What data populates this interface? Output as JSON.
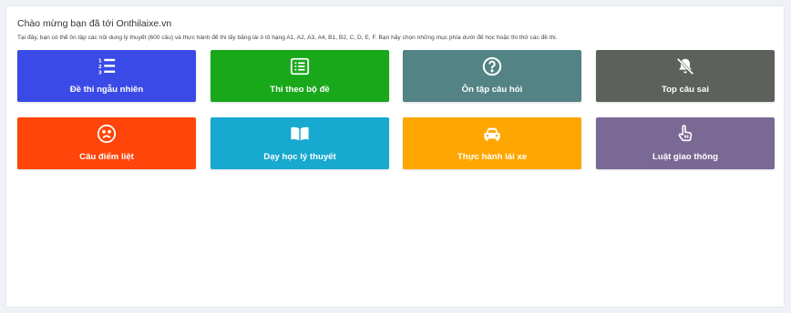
{
  "header": {
    "welcome": "Chào mừng bạn đã tới Onthilaixe.vn",
    "intro": "Tại đây, bạn có thể ôn tập các nội dung lý thuyết (600 câu) và thực hành để thi lấy bằng lái ô tô hạng A1, A2, A3, A4, B1, B2, C, D, E, F. Bạn hãy chọn những mục phía dưới để học hoặc thi thử các đề thi."
  },
  "tiles": [
    {
      "label": "Đề thi ngẫu nhiên",
      "icon": "numbered-list-icon",
      "color": "#3a4ae6"
    },
    {
      "label": "Thi theo bộ đề",
      "icon": "list-alt-icon",
      "color": "#18a81a"
    },
    {
      "label": "Ôn tập câu hỏi",
      "icon": "question-circle-icon",
      "color": "#538384"
    },
    {
      "label": "Top câu sai",
      "icon": "bell-slash-icon",
      "color": "#5c615c"
    },
    {
      "label": "Câu điểm liệt",
      "icon": "frown-icon",
      "color": "#ff4509"
    },
    {
      "label": "Dạy học lý thuyết",
      "icon": "open-book-icon",
      "color": "#17a9cf"
    },
    {
      "label": "Thực hành lái xe",
      "icon": "car-icon",
      "color": "#ffa600"
    },
    {
      "label": "Luật giao thông",
      "icon": "hand-pointer-icon",
      "color": "#7a6895"
    }
  ]
}
